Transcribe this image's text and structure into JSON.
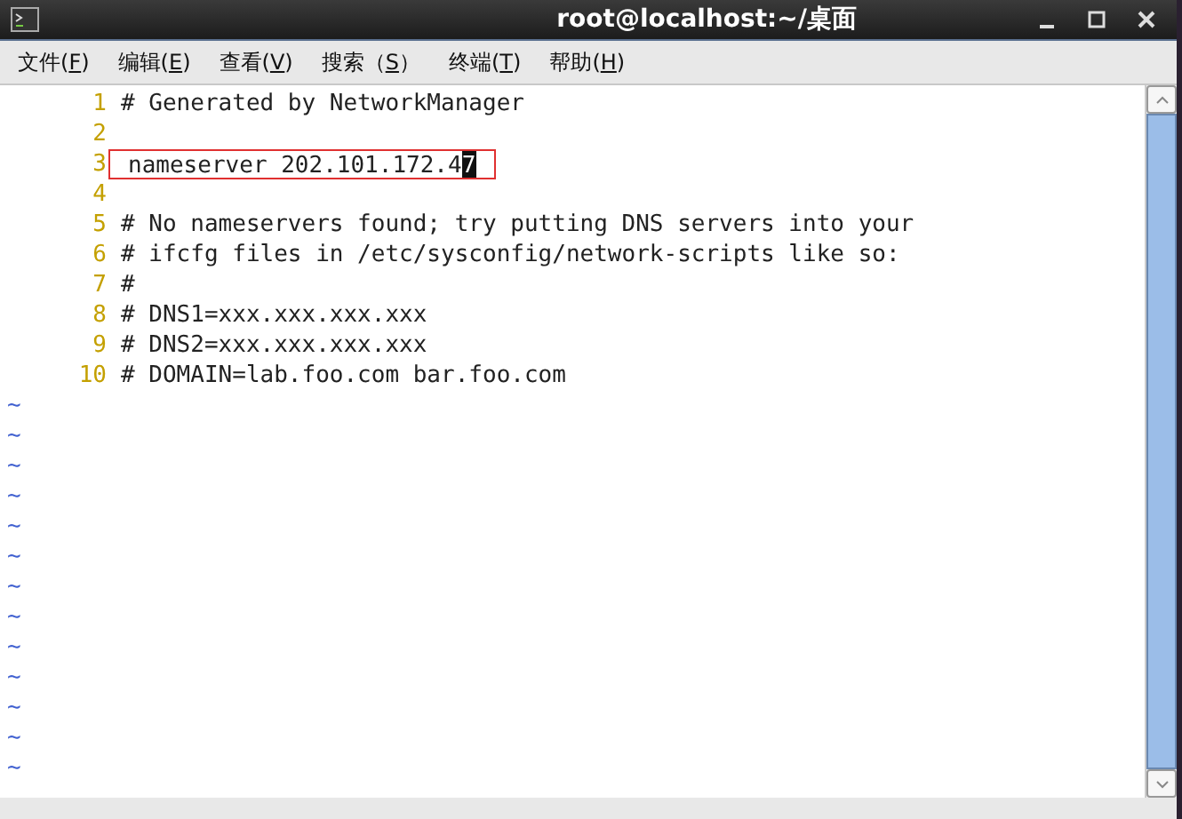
{
  "window": {
    "title": "root@localhost:~/桌面"
  },
  "menu": [
    {
      "before": "文件(",
      "key": "F",
      "after": ")"
    },
    {
      "before": "编辑(",
      "key": "E",
      "after": ")"
    },
    {
      "before": "查看(",
      "key": "V",
      "after": ")"
    },
    {
      "before": "搜索（",
      "key": "S",
      "after": "）"
    },
    {
      "before": "终端(",
      "key": "T",
      "after": ")"
    },
    {
      "before": "帮助(",
      "key": "H",
      "after": ")"
    }
  ],
  "editor": {
    "lines": [
      {
        "number": "1",
        "text": "# Generated by NetworkManager",
        "marked": false
      },
      {
        "number": "2",
        "marked": false
      },
      {
        "number": "3",
        "text": "nameserver 202.101.172.4",
        "cursor_char": "7",
        "marked": true
      },
      {
        "number": "4",
        "marked": false
      },
      {
        "number": "5",
        "text": "# No nameservers found; try putting DNS servers into your",
        "marked": false
      },
      {
        "number": "6",
        "text": "# ifcfg files in /etc/sysconfig/network-scripts like so:",
        "marked": false
      },
      {
        "number": "7",
        "text": "#",
        "marked": false
      },
      {
        "number": "8",
        "text": "# DNS1=xxx.xxx.xxx.xxx",
        "marked": false
      },
      {
        "number": "9",
        "text": "# DNS2=xxx.xxx.xxx.xxx",
        "marked": false
      },
      {
        "number": "10",
        "text": "# DOMAIN=lab.foo.com bar.foo.com",
        "marked": false
      }
    ],
    "empty_lines": [
      "~",
      "~",
      "~",
      "~",
      "~",
      "~",
      "~",
      "~",
      "~",
      "~",
      "~",
      "~",
      "~"
    ]
  }
}
